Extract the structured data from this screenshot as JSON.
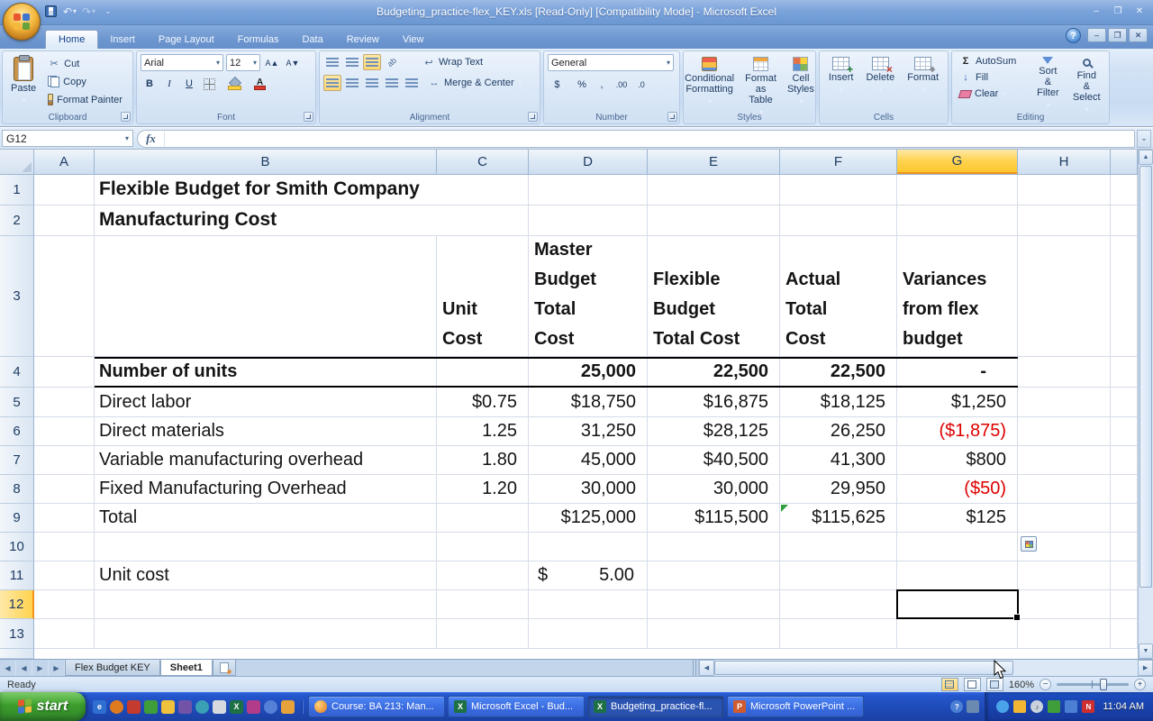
{
  "title_bar": {
    "title": "Budgeting_practice-flex_KEY.xls  [Read-Only]  [Compatibility Mode] - Microsoft Excel"
  },
  "icons": {
    "dropdown": "▾",
    "cut": "✂",
    "undo": "↶",
    "redo": "↷",
    "help": "?",
    "minimize": "–",
    "restore": "❐",
    "close": "✕",
    "up": "▲",
    "down": "▼",
    "left": "◀",
    "right": "▶",
    "sigma": "Σ",
    "merge_arrows": "↔",
    "wrap_arrow": "↩",
    "orientation": "ab",
    "fill_arrow": "↓",
    "chevron": "⌄",
    "grow": "A▲",
    "shrink": "A▼"
  },
  "ribbon": {
    "tabs": [
      "Home",
      "Insert",
      "Page Layout",
      "Formulas",
      "Data",
      "Review",
      "View"
    ],
    "clipboard": {
      "label": "Clipboard",
      "paste": "Paste",
      "cut": "Cut",
      "copy": "Copy",
      "format_painter": "Format Painter"
    },
    "font": {
      "label": "Font",
      "name": "Arial",
      "size": "12",
      "bold": "B",
      "italic": "I",
      "underline": "U"
    },
    "alignment": {
      "label": "Alignment",
      "wrap": "Wrap Text",
      "merge": "Merge & Center"
    },
    "number": {
      "label": "Number",
      "format": "General",
      "currency": "$",
      "percent": "%",
      "comma": ",",
      "inc_decimal": ".00",
      "dec_decimal": ".0"
    },
    "styles": {
      "label": "Styles",
      "conditional": "Conditional\nFormatting",
      "format_table": "Format\nas Table",
      "cell_styles": "Cell\nStyles"
    },
    "cells": {
      "label": "Cells",
      "insert": "Insert",
      "delete": "Delete",
      "format": "Format"
    },
    "editing": {
      "label": "Editing",
      "autosum": "AutoSum",
      "fill": "Fill",
      "clear": "Clear",
      "sort_filter": "Sort &\nFilter",
      "find_select": "Find &\nSelect"
    }
  },
  "formula_bar": {
    "name_box": "G12",
    "fx": "fx",
    "formula": ""
  },
  "grid": {
    "cols": [
      "A",
      "B",
      "C",
      "D",
      "E",
      "F",
      "G",
      "H"
    ],
    "rows": [
      "1",
      "2",
      "3",
      "4",
      "5",
      "6",
      "7",
      "8",
      "9",
      "10",
      "11",
      "12",
      "13"
    ],
    "selected_cell": "G12"
  },
  "cells": {
    "title1": "Flexible Budget for Smith Company",
    "title2": "Manufacturing Cost",
    "h_c": "Unit\nCost",
    "h_d": "Master\nBudget\nTotal\nCost",
    "h_e": "Flexible\nBudget\nTotal Cost",
    "h_f": "Actual\nTotal\nCost",
    "h_g": "Variances\nfrom flex\nbudget",
    "r4": {
      "b": "Number of units",
      "d": "25,000",
      "e": "22,500",
      "f": "22,500",
      "g": "-"
    },
    "r5": {
      "b": "Direct labor",
      "c": "$0.75",
      "d": "$18,750",
      "e": "$16,875",
      "f": "$18,125",
      "g": "$1,250"
    },
    "r6": {
      "b": "Direct materials",
      "c": "1.25",
      "d": "31,250",
      "e": "$28,125",
      "f": "26,250",
      "g": "($1,875)"
    },
    "r7": {
      "b": "Variable manufacturing overhead",
      "c": "1.80",
      "d": "45,000",
      "e": "$40,500",
      "f": "41,300",
      "g": "$800"
    },
    "r8": {
      "b": "Fixed Manufacturing Overhead",
      "c": "1.20",
      "d": "30,000",
      "e": "30,000",
      "f": "29,950",
      "g": "($50)"
    },
    "r9": {
      "b": "Total",
      "d": "$125,000",
      "e": "$115,500",
      "f": "$115,625",
      "g": "$125"
    },
    "r11": {
      "b": "Unit cost",
      "sym": "$",
      "val": "5.00"
    }
  },
  "sheet_tabs": {
    "tabs": [
      "Flex Budget KEY",
      "Sheet1"
    ],
    "active": "Sheet1"
  },
  "status_bar": {
    "mode": "Ready",
    "zoom": "160%"
  },
  "taskbar": {
    "start": "start",
    "tasks": [
      {
        "label": "Course: BA 213: Man..."
      },
      {
        "label": "Microsoft Excel - Bud..."
      },
      {
        "label": "Budgeting_practice-fl..."
      },
      {
        "label": "Microsoft PowerPoint ..."
      }
    ],
    "time": "11:04 AM"
  }
}
